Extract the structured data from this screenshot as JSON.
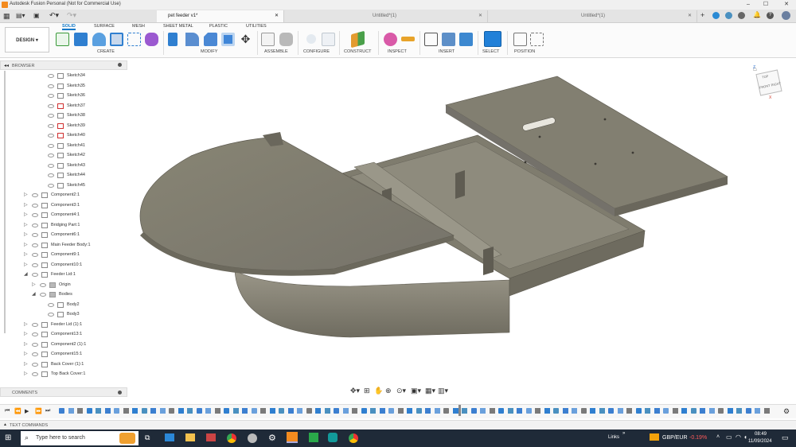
{
  "window": {
    "title": "Autodesk Fusion Personal (Not for Commercial Use)",
    "controls": [
      "–",
      "☐",
      "✕"
    ]
  },
  "tabs": [
    {
      "label": "pet feeder v1*",
      "active": true
    },
    {
      "label": "Untitled*(1)",
      "active": false
    },
    {
      "label": "Untitled*(1)",
      "active": false
    }
  ],
  "workspace": {
    "label": "DESIGN"
  },
  "ribbon_tabs": [
    "SOLID",
    "SURFACE",
    "MESH",
    "SHEET METAL",
    "PLASTIC",
    "UTILITIES"
  ],
  "tool_groups": [
    {
      "label": "CREATE"
    },
    {
      "label": "MODIFY"
    },
    {
      "label": "ASSEMBLE"
    },
    {
      "label": "CONFIGURE"
    },
    {
      "label": "CONSTRUCT"
    },
    {
      "label": "INSPECT"
    },
    {
      "label": "INSERT"
    },
    {
      "label": "SELECT"
    },
    {
      "label": "POSITION"
    }
  ],
  "browser": {
    "label": "BROWSER",
    "items": [
      {
        "label": "Sketch34",
        "level": 3,
        "type": "sketch"
      },
      {
        "label": "Sketch35",
        "level": 3,
        "type": "sketch"
      },
      {
        "label": "Sketch36",
        "level": 3,
        "type": "sketch"
      },
      {
        "label": "Sketch37",
        "level": 3,
        "type": "sketch-red"
      },
      {
        "label": "Sketch38",
        "level": 3,
        "type": "sketch"
      },
      {
        "label": "Sketch39",
        "level": 3,
        "type": "sketch-red"
      },
      {
        "label": "Sketch40",
        "level": 3,
        "type": "sketch-red"
      },
      {
        "label": "Sketch41",
        "level": 3,
        "type": "sketch"
      },
      {
        "label": "Sketch42",
        "level": 3,
        "type": "sketch"
      },
      {
        "label": "Sketch43",
        "level": 3,
        "type": "sketch"
      },
      {
        "label": "Sketch44",
        "level": 3,
        "type": "sketch"
      },
      {
        "label": "Sketch45",
        "level": 3,
        "type": "sketch"
      },
      {
        "label": "Component2:1",
        "level": 1,
        "type": "component"
      },
      {
        "label": "Component3:1",
        "level": 1,
        "type": "component"
      },
      {
        "label": "Component4:1",
        "level": 1,
        "type": "component"
      },
      {
        "label": "Bridging Part:1",
        "level": 1,
        "type": "component"
      },
      {
        "label": "Component6:1",
        "level": 1,
        "type": "component"
      },
      {
        "label": "Main Feeder Body:1",
        "level": 1,
        "type": "component"
      },
      {
        "label": "Component9:1",
        "level": 1,
        "type": "component"
      },
      {
        "label": "Component10:1",
        "level": 1,
        "type": "component"
      },
      {
        "label": "Feeder Lid:1",
        "level": 1,
        "type": "component-open"
      },
      {
        "label": "Origin",
        "level": 2,
        "type": "folder"
      },
      {
        "label": "Bodies",
        "level": 2,
        "type": "folder-open"
      },
      {
        "label": "Body2",
        "level": 3,
        "type": "body"
      },
      {
        "label": "Body3",
        "level": 3,
        "type": "body"
      },
      {
        "label": "Feeder Lid (1):1",
        "level": 1,
        "type": "component"
      },
      {
        "label": "Component13:1",
        "level": 1,
        "type": "component"
      },
      {
        "label": "Component2 (1):1",
        "level": 1,
        "type": "component"
      },
      {
        "label": "Component15:1",
        "level": 1,
        "type": "component"
      },
      {
        "label": "Back Cover (1):1",
        "level": 1,
        "type": "component"
      },
      {
        "label": "Top Back Cover:1",
        "level": 1,
        "type": "component"
      }
    ]
  },
  "comments": {
    "label": "COMMENTS"
  },
  "text_commands": {
    "label": "TEXT COMMANDS"
  },
  "viewcube": {
    "top": "TOP",
    "front": "FRONT",
    "right": "RIGHT",
    "axis_x": "X",
    "axis_z": "Z"
  },
  "taskbar": {
    "search_placeholder": "Type here to search",
    "links_label": "Links",
    "ticker_label": "GBP/EUR",
    "ticker_value": "-0.19%",
    "time": "08:49",
    "date": "11/09/2024"
  },
  "colors": {
    "accent": "#0f78c8",
    "model": "#8a8678",
    "taskbar": "#1f2a38",
    "ticker_neg": "#ff5a5a"
  }
}
